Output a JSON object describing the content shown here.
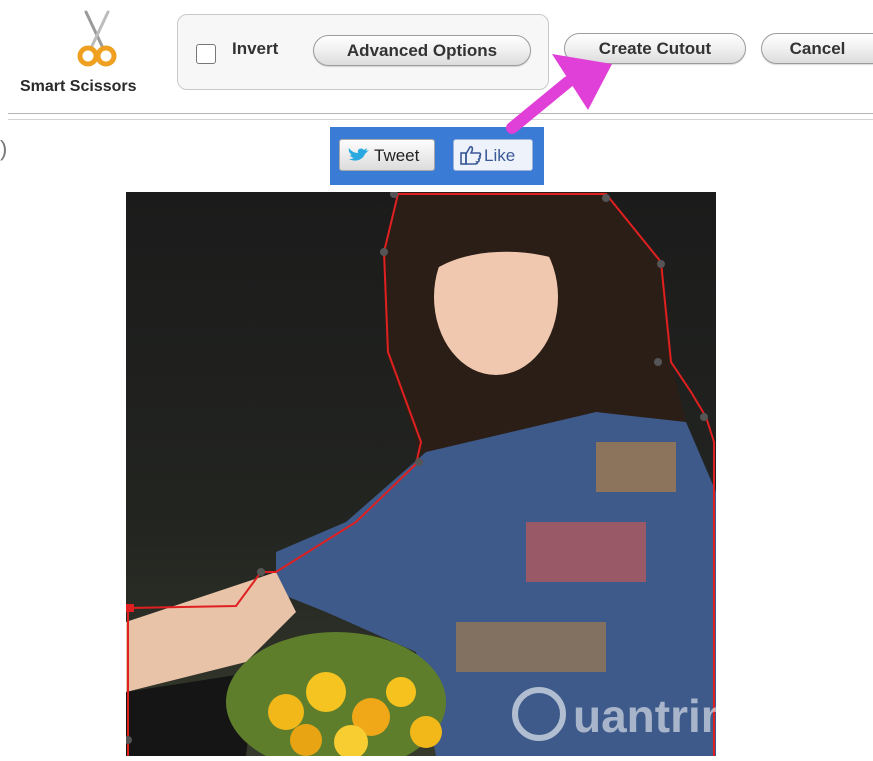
{
  "toolbar": {
    "tool_label": "Smart Scissors",
    "invert_label": "Invert",
    "invert_checked": false,
    "advanced_label": "Advanced Options",
    "create_label": "Create Cutout",
    "cancel_label": "Cancel"
  },
  "social": {
    "tweet_label": "Tweet",
    "like_label": "Like",
    "box_color": "#3a7bd5"
  },
  "misc": {
    "left_paren": ")"
  },
  "colors": {
    "arrow": "#e040d8",
    "cutout_outline": "#e02020",
    "tool_icon": "#f0a020"
  },
  "watermark": {
    "text": "uantrimang"
  }
}
